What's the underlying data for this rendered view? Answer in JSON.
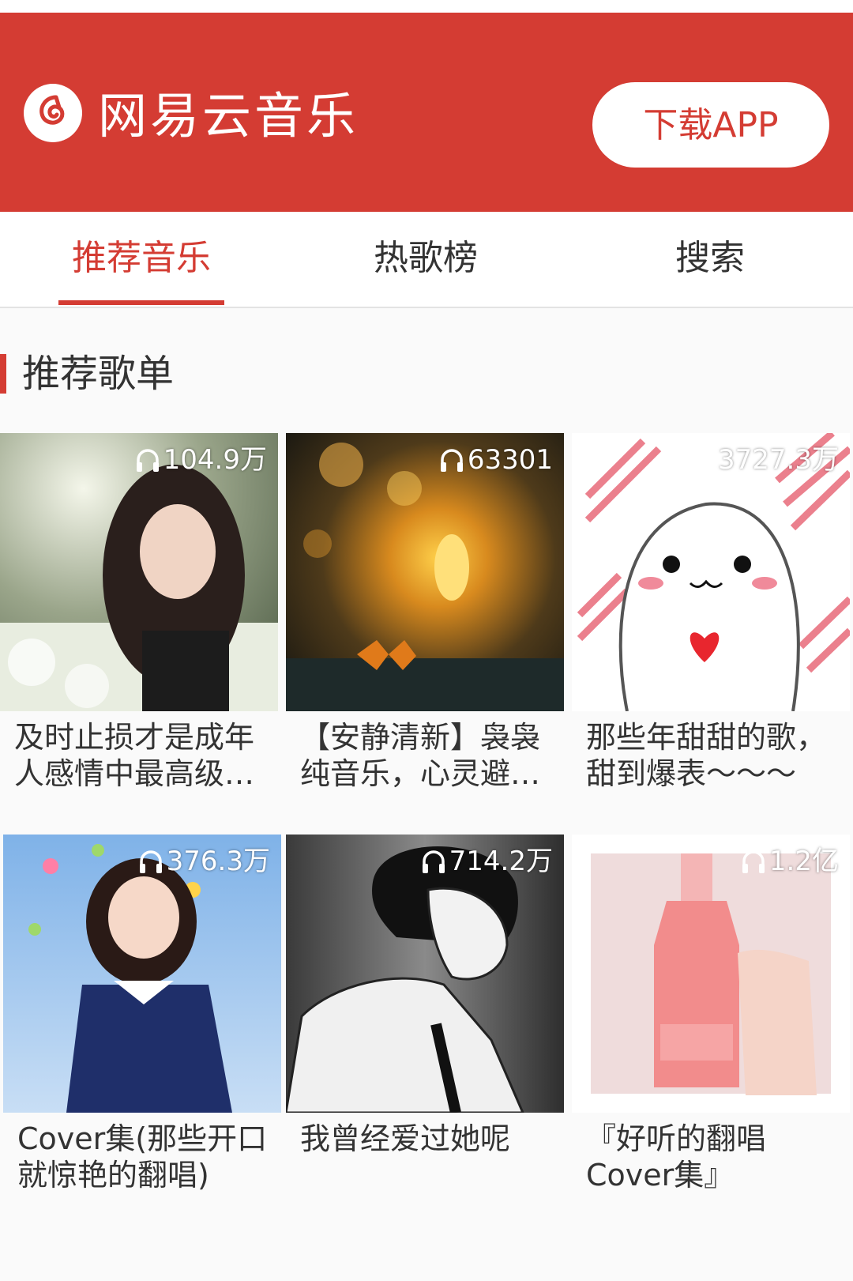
{
  "header": {
    "brand": "网易云音乐",
    "download_label": "下载APP",
    "logo_icon": "netease-logo-icon",
    "bg_color": "#d43c33"
  },
  "tabs": [
    {
      "label": "推荐音乐",
      "active": true
    },
    {
      "label": "热歌榜",
      "active": false
    },
    {
      "label": "搜索",
      "active": false
    }
  ],
  "section": {
    "title": "推荐歌单"
  },
  "playlists": [
    {
      "title": "及时止损才是成年人感情中最高级…",
      "plays": "104.9万",
      "cover": "girl-in-garden"
    },
    {
      "title": "【安静清新】袅袅纯音乐，心灵避…",
      "plays": "63301",
      "cover": "candle-butterfly"
    },
    {
      "title": "那些年甜甜的歌，甜到爆表～～～",
      "plays": "3727.3万",
      "cover": "cute-cartoon-heart"
    },
    {
      "title": "Cover集(那些开口就惊艳的翻唱)",
      "plays": "376.3万",
      "cover": "girl-with-flowers"
    },
    {
      "title": "我曾经爱过她呢",
      "plays": "714.2万",
      "cover": "anime-boy-sketch"
    },
    {
      "title": "『好听的翻唱Cover集』",
      "plays": "1.2亿",
      "cover": "pink-bottle"
    }
  ],
  "accent_color": "#d43c33"
}
